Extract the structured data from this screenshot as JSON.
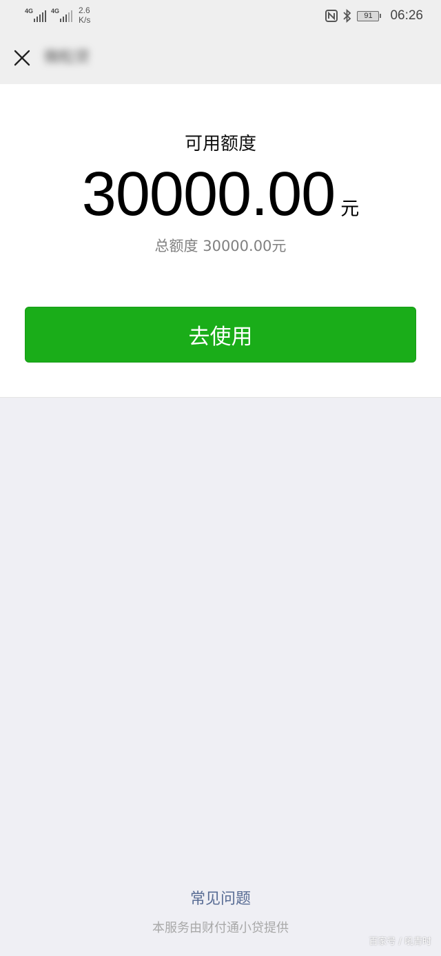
{
  "status_bar": {
    "network_1": "4G",
    "network_2": "4G",
    "speed_value": "2.6",
    "speed_unit": "K/s",
    "nfc_icon": "nfc-icon",
    "bluetooth_icon": "bluetooth-icon",
    "battery_level": "91",
    "time": "06:26"
  },
  "nav": {
    "close_icon": "close-icon",
    "title": "微粒贷"
  },
  "credit": {
    "label": "可用额度",
    "amount": "30000.00",
    "unit": "元",
    "total_label": "总额度 30000.00元"
  },
  "actions": {
    "use_label": "去使用"
  },
  "footer": {
    "faq_label": "常见问题",
    "provider_text": "本服务由财付通小贷提供",
    "watermark": "百家号 / 吼青时"
  },
  "colors": {
    "primary_green": "#1aad19",
    "link_blue": "#586c94",
    "page_bg": "#efeff4"
  }
}
